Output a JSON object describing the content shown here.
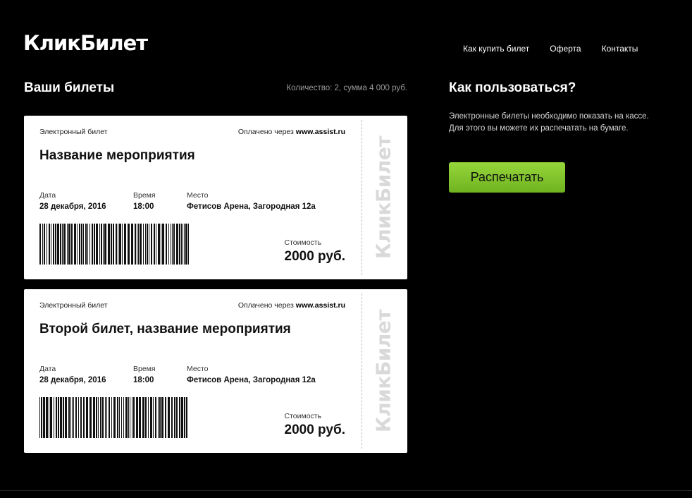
{
  "header": {
    "logo": "КликБилет",
    "nav": [
      "Как купить билет",
      "Оферта",
      "Контакты"
    ]
  },
  "tickets_section": {
    "title": "Ваши билеты",
    "summary": "Количество: 2, сумма 4 000 руб."
  },
  "tickets": [
    {
      "kind": "Электронный билет",
      "paid_prefix": "Оплачено через",
      "paid_site": "www.assist.ru",
      "name": "Название мероприятия",
      "date_label": "Дата",
      "date": "28 декабря, 2016",
      "time_label": "Время",
      "time": "18:00",
      "place_label": "Место",
      "place": "Фетисов Арена, Загородная 12а",
      "cost_label": "Стоимость",
      "price": "2000 руб.",
      "stub": "КликБилет"
    },
    {
      "kind": "Электронный билет",
      "paid_prefix": "Оплачено через",
      "paid_site": "www.assist.ru",
      "name": "Второй билет, название мероприятия",
      "date_label": "Дата",
      "date": "28 декабря, 2016",
      "time_label": "Время",
      "time": "18:00",
      "place_label": "Место",
      "place": "Фетисов Арена, Загородная 12а",
      "cost_label": "Стоимость",
      "price": "2000 руб.",
      "stub": "КликБилет"
    }
  ],
  "help": {
    "title": "Как пользоваться?",
    "text": "Электронные билеты необходимо показать на кассе. Для этого вы можете их распечатать на бумаге.",
    "print_button": "Распечатать"
  },
  "colors": {
    "background": "#000000",
    "button": "#86c62f",
    "ticket": "#ffffff"
  }
}
